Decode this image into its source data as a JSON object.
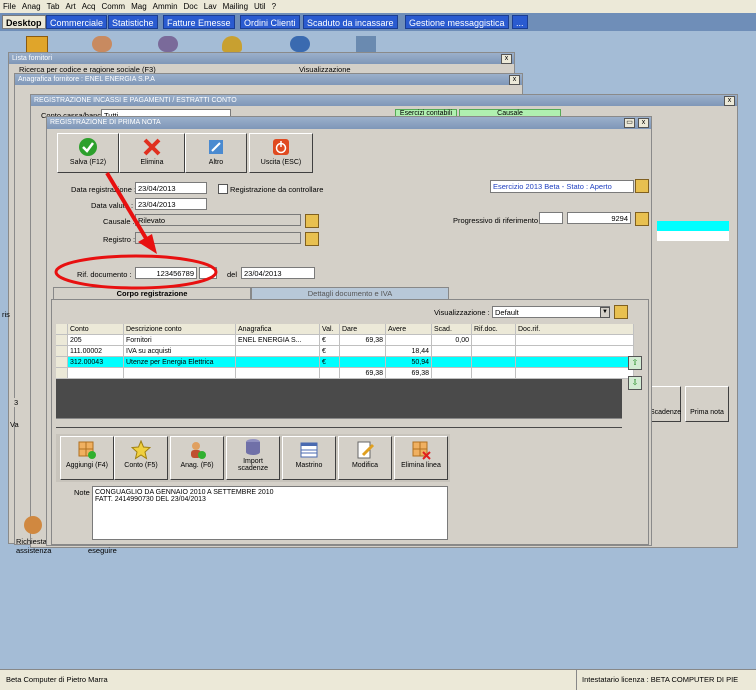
{
  "menu": [
    "File",
    "Anag",
    "Tab",
    "Art",
    "Acq",
    "Comm",
    "Mag",
    "Ammin",
    "Doc",
    "Lav",
    "Mailing",
    "Util",
    "?"
  ],
  "tabs": [
    "Desktop",
    "Commerciale",
    "Statistiche",
    "Fatture Emesse",
    "Ordini Clienti",
    "Scaduto da incassare",
    "Gestione messaggistica",
    "..."
  ],
  "bg_windows": {
    "lista_fornitori": {
      "title": "Lista fornitori",
      "search_label": "Ricerca per codice e ragione sociale (F3)",
      "view_label": "Visualizzazione"
    },
    "anagrafica": {
      "title": "Anagrafica fornitore : ENEL ENERGIA S.P.A"
    },
    "registrazione": {
      "title": "REGISTRAZIONE INCASSI E PAGAMENTI / ESTRATTI CONTO",
      "option1": "Conto cassa/banca",
      "option1_value": "Tutti",
      "esercizi": "Esercizi contabili",
      "causale": "Causale"
    }
  },
  "prima_nota": {
    "title": "REGISTRAZIONE DI PRIMA NOTA",
    "toolbar": {
      "save": "Salva (F12)",
      "delete": "Elimina",
      "other": "Altro",
      "exit": "Uscita (ESC)"
    },
    "data_registrazione_label": "Data registrazione :",
    "data_registrazione": "23/04/2013",
    "data_valuta_label": "Data valuta :",
    "data_valuta": "23/04/2013",
    "da_controllare_label": "Registrazione da controllare",
    "esercizio": "Esercizio 2013 Beta - Stato : Aperto",
    "causale_label": "Causale :",
    "causale_value": "Rilevato",
    "registro_label": "Registro :",
    "progressivo_label": "Progressivo di riferimento :",
    "progressivo_value": "9294",
    "rif_documento_label": "Rif. documento :",
    "rif_documento": "123456789",
    "del_label": "del",
    "del_value": "23/04/2013",
    "tab_corpo": "Corpo registrazione",
    "tab_dettagli": "Dettagli documento e IVA",
    "visualizzazione_label": "Visualizzazione :",
    "visualizzazione_value": "Default",
    "columns": [
      "Conto",
      "Descrizione conto",
      "Anagrafica",
      "Val.",
      "Dare",
      "Avere",
      "Scad.",
      "Rif.doc.",
      "Doc.rif."
    ],
    "rows": [
      [
        "205",
        "Fornitori",
        "ENEL ENERGIA S...",
        "€",
        "69,38",
        "",
        "0,00",
        "",
        ""
      ],
      [
        "111.00002",
        "IVA su acquisti",
        "",
        "€",
        "",
        "18,44",
        "",
        "",
        ""
      ],
      [
        "312.00043",
        "Utenze per Energia Elettrica",
        "",
        "€",
        "",
        "50,94",
        "",
        "",
        ""
      ],
      [
        "",
        "",
        "",
        "",
        "69,38",
        "69,38",
        "",
        "",
        ""
      ]
    ],
    "actions": {
      "add": "Aggiungi (F4)",
      "conto": "Conto (F5)",
      "anag": "Anag. (F6)",
      "import_line1": "Import",
      "import_line2": "scadenze",
      "mastrino": "Mastrino",
      "modifica": "Modifica",
      "elimina": "Elimina linea"
    },
    "note_label": "Note :",
    "note_line1": "CONGUAGLIO DA GENNAIO 2010 A SETTEMBRE 2010",
    "note_line2": "FATT. 2414990730 DEL 23/04/2013"
  },
  "right_panel": {
    "scadenze": "Scadenze",
    "prima_nota": "Prima nota"
  },
  "desktop": {
    "richiesta1": "Richiesta",
    "richiesta2": "assistenza",
    "eseguire": "eseguire"
  },
  "status": {
    "left": "Beta Computer di Pietro Marra",
    "right": "Intestatario licenza : BETA COMPUTER DI PIE"
  },
  "colors": {
    "desktop": "#a4bcd6",
    "highlight": "#00ffff",
    "annotation": "#e81010",
    "tab_blue": "#2a5bd0"
  }
}
